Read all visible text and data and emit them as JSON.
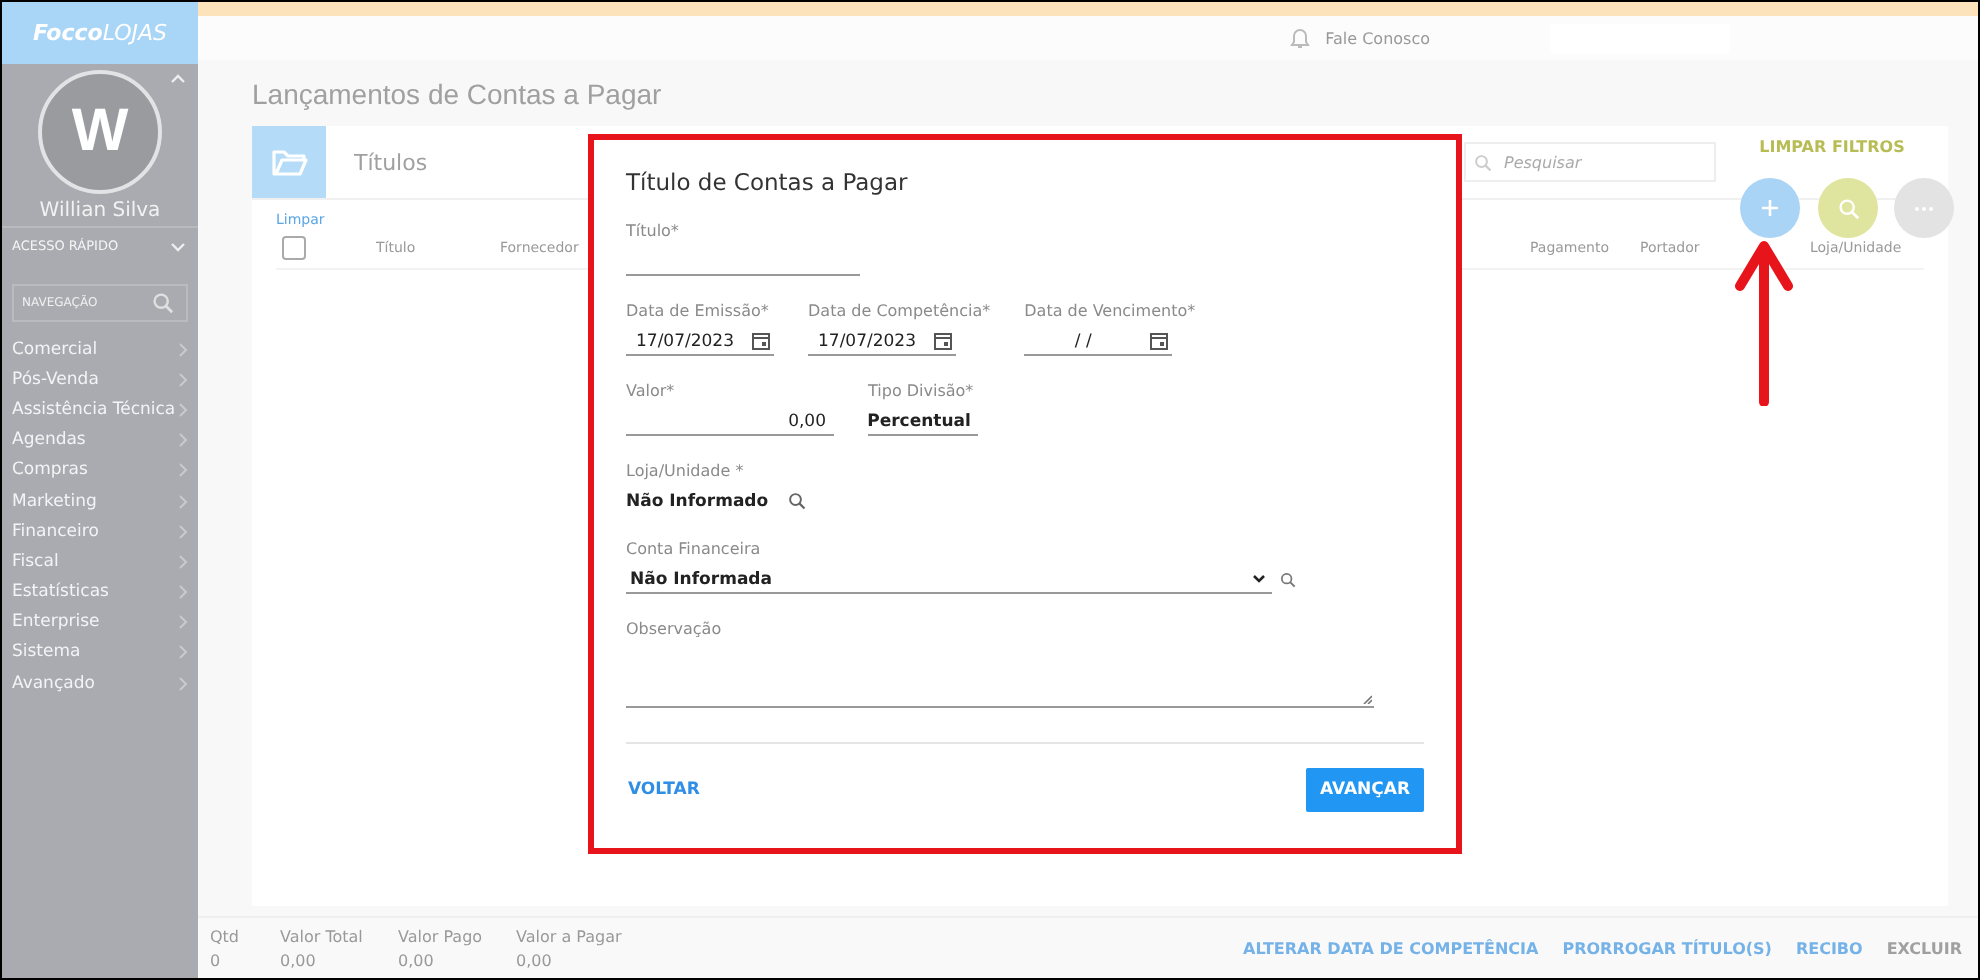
{
  "sidebar": {
    "logo": {
      "part_1": "Focco",
      "part_2": "LOJAS"
    },
    "avatar_initial": "W",
    "user_name": "Willian Silva",
    "quick_access": "ACESSO RÁPIDO",
    "nav_search": "NAVEGAÇÃO",
    "items": [
      "Comercial",
      "Pós-Venda",
      "Assistência Técnica",
      "Agendas",
      "Compras",
      "Marketing",
      "Financeiro",
      "Fiscal",
      "Estatísticas",
      "Enterprise",
      "Sistema",
      "Avançado"
    ]
  },
  "topbar": {
    "contact": "Fale Conosco"
  },
  "page_title": "Lançamentos de Contas a Pagar",
  "card": {
    "tab": "Títulos",
    "select_all_checked": false,
    "search_placeholder": "Pesquisar",
    "clear_filters": "LIMPAR FILTROS",
    "clear_selection": "Limpar",
    "columns": [
      "Título",
      "Fornecedor",
      "Pagamento",
      "Portador",
      "Loja/Unidade"
    ]
  },
  "footer": {
    "totals": [
      {
        "label": "Qtd",
        "value": "0"
      },
      {
        "label": "Valor Total",
        "value": "0,00"
      },
      {
        "label": "Valor Pago",
        "value": "0,00"
      },
      {
        "label": "Valor a Pagar",
        "value": "0,00"
      }
    ],
    "actions": [
      "ALTERAR DATA DE COMPETÊNCIA",
      "PRORROGAR TÍTULO(S)",
      "RECIBO",
      "EXCLUIR"
    ]
  },
  "modal": {
    "title": "Título de Contas a Pagar",
    "rows": [
      [
        {
          "kind": "text",
          "label": "Título*"
        }
      ],
      [
        {
          "kind": "date",
          "label": "Data de Emissão*",
          "value": "17/07/2023"
        },
        {
          "kind": "date",
          "label": "Data de Competência*",
          "value": "17/07/2023"
        },
        {
          "kind": "date",
          "label": "Data de Vencimento*",
          "value": "/ /"
        }
      ],
      [
        {
          "kind": "number",
          "label": "Valor*",
          "value": "0,00"
        },
        {
          "kind": "select",
          "label": "Tipo Divisão*",
          "value": "Percentual"
        }
      ],
      [
        {
          "kind": "lookup",
          "label": "Loja/Unidade *",
          "value": "Não Informado"
        }
      ],
      [
        {
          "kind": "select_lookup",
          "label": "Conta Financeira",
          "value": "Não Informada"
        }
      ],
      [
        {
          "kind": "textarea",
          "label": "Observação"
        }
      ]
    ],
    "back": "VOLTAR",
    "next": "AVANÇAR"
  }
}
